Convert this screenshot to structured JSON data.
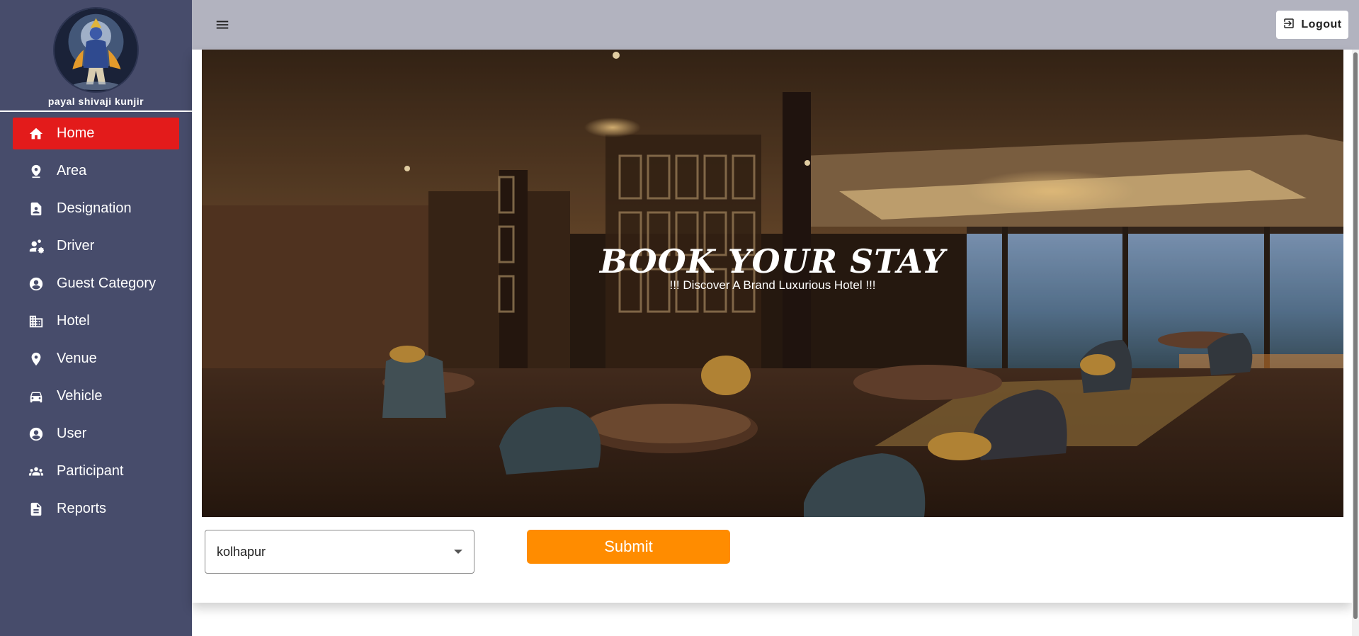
{
  "sidebar": {
    "user_name": "payal shivaji kunjir",
    "items": [
      {
        "label": "Home",
        "icon": "home-icon",
        "active": true
      },
      {
        "label": "Area",
        "icon": "location-pin-icon"
      },
      {
        "label": "Designation",
        "icon": "badge-document-icon"
      },
      {
        "label": "Driver",
        "icon": "people-gear-icon"
      },
      {
        "label": "Guest Category",
        "icon": "account-circle-icon"
      },
      {
        "label": "Hotel",
        "icon": "building-icon"
      },
      {
        "label": "Venue",
        "icon": "place-marker-icon"
      },
      {
        "label": "Vehicle",
        "icon": "car-icon"
      },
      {
        "label": "User",
        "icon": "account-circle-icon"
      },
      {
        "label": "Participant",
        "icon": "group-icon"
      },
      {
        "label": "Reports",
        "icon": "document-icon"
      }
    ]
  },
  "header": {
    "menu_icon": "menu-icon",
    "logout_label": "Logout",
    "logout_icon": "logout-icon"
  },
  "hero": {
    "title": "BOOK YOUR STAY",
    "subtitle": "!!! Discover A Brand Luxurious Hotel !!!"
  },
  "form": {
    "city_value": "kolhapur",
    "submit_label": "Submit"
  },
  "colors": {
    "sidebar": "#474c6b",
    "active_item": "#e31b1b",
    "topbar": "#b2b3bf",
    "submit": "#ff8c00"
  }
}
